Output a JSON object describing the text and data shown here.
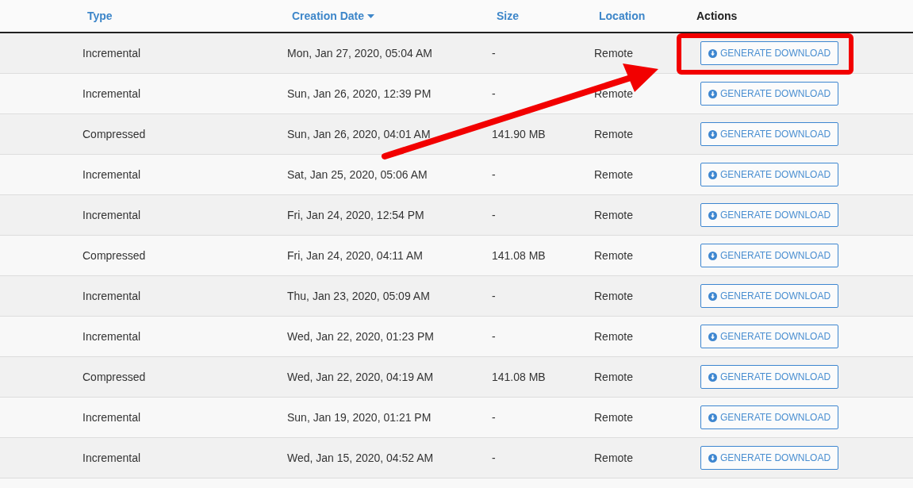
{
  "table": {
    "columns": [
      {
        "label": "Type",
        "sortable": true,
        "sorted": false
      },
      {
        "label": "Creation Date",
        "sortable": true,
        "sorted": true
      },
      {
        "label": "Size",
        "sortable": true,
        "sorted": false
      },
      {
        "label": "Location",
        "sortable": true,
        "sorted": false
      },
      {
        "label": "Actions",
        "sortable": false,
        "sorted": false
      }
    ],
    "rows": [
      {
        "type": "Incremental",
        "date": "Mon, Jan 27, 2020, 05:04 AM",
        "size": "-",
        "location": "Remote",
        "action": "GENERATE DOWNLOAD"
      },
      {
        "type": "Incremental",
        "date": "Sun, Jan 26, 2020, 12:39 PM",
        "size": "-",
        "location": "Remote",
        "action": "GENERATE DOWNLOAD"
      },
      {
        "type": "Compressed",
        "date": "Sun, Jan 26, 2020, 04:01 AM",
        "size": "141.90 MB",
        "location": "Remote",
        "action": "GENERATE DOWNLOAD"
      },
      {
        "type": "Incremental",
        "date": "Sat, Jan 25, 2020, 05:06 AM",
        "size": "-",
        "location": "Remote",
        "action": "GENERATE DOWNLOAD"
      },
      {
        "type": "Incremental",
        "date": "Fri, Jan 24, 2020, 12:54 PM",
        "size": "-",
        "location": "Remote",
        "action": "GENERATE DOWNLOAD"
      },
      {
        "type": "Compressed",
        "date": "Fri, Jan 24, 2020, 04:11 AM",
        "size": "141.08 MB",
        "location": "Remote",
        "action": "GENERATE DOWNLOAD"
      },
      {
        "type": "Incremental",
        "date": "Thu, Jan 23, 2020, 05:09 AM",
        "size": "-",
        "location": "Remote",
        "action": "GENERATE DOWNLOAD"
      },
      {
        "type": "Incremental",
        "date": "Wed, Jan 22, 2020, 01:23 PM",
        "size": "-",
        "location": "Remote",
        "action": "GENERATE DOWNLOAD"
      },
      {
        "type": "Compressed",
        "date": "Wed, Jan 22, 2020, 04:19 AM",
        "size": "141.08 MB",
        "location": "Remote",
        "action": "GENERATE DOWNLOAD"
      },
      {
        "type": "Incremental",
        "date": "Sun, Jan 19, 2020, 01:21 PM",
        "size": "-",
        "location": "Remote",
        "action": "GENERATE DOWNLOAD"
      },
      {
        "type": "Incremental",
        "date": "Wed, Jan 15, 2020, 04:52 AM",
        "size": "-",
        "location": "Remote",
        "action": "GENERATE DOWNLOAD"
      }
    ]
  }
}
